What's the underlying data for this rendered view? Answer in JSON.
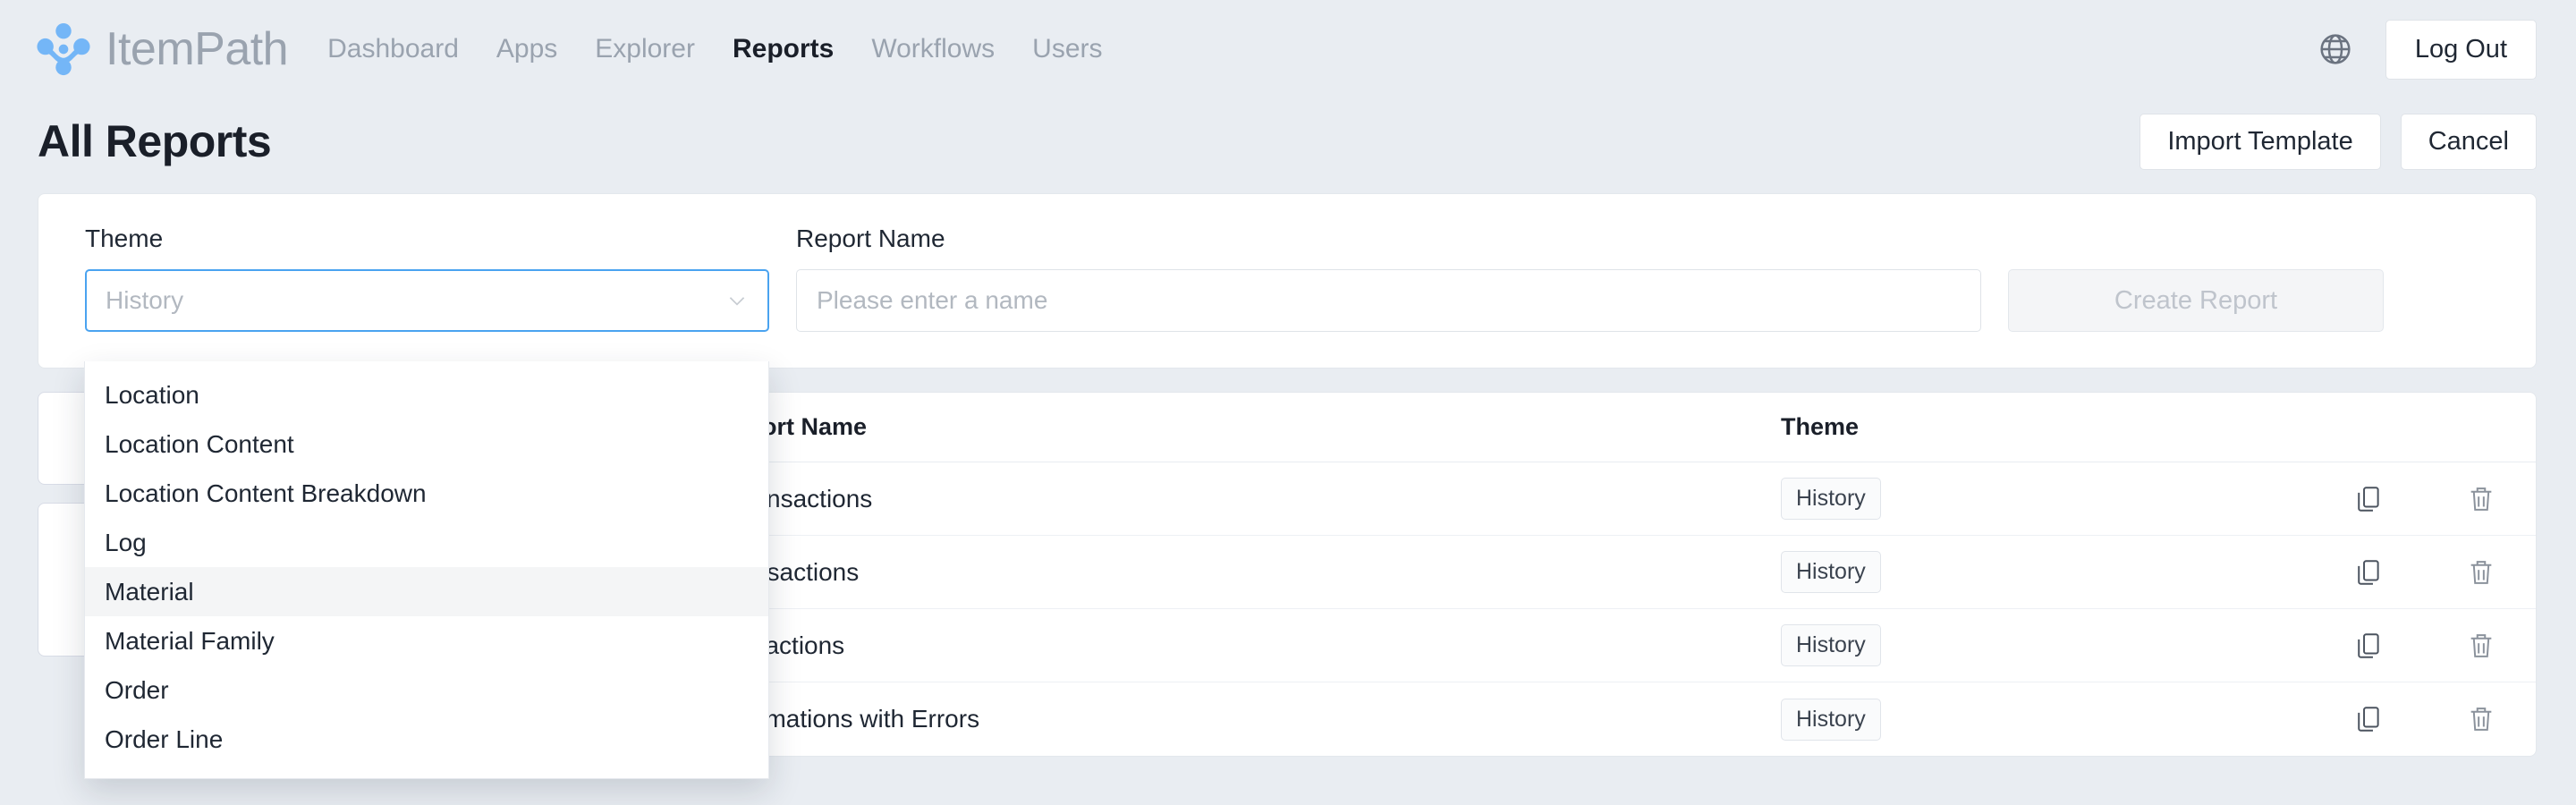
{
  "header": {
    "brand_name": "ItemPath",
    "brand_icon": "itempath-logo-icon",
    "nav": [
      {
        "label": "Dashboard",
        "active": false
      },
      {
        "label": "Apps",
        "active": false
      },
      {
        "label": "Explorer",
        "active": false
      },
      {
        "label": "Reports",
        "active": true
      },
      {
        "label": "Workflows",
        "active": false
      },
      {
        "label": "Users",
        "active": false
      }
    ],
    "language_icon": "globe-icon",
    "logout_label": "Log Out"
  },
  "titlebar": {
    "title": "All Reports",
    "import_label": "Import Template",
    "cancel_label": "Cancel"
  },
  "create_panel": {
    "theme_label": "Theme",
    "theme_value": "History",
    "chevron_icon": "chevron-down-icon",
    "name_label": "Report Name",
    "name_value": "",
    "name_placeholder": "Please enter a name",
    "create_label": "Create Report",
    "create_disabled": true
  },
  "theme_dropdown": {
    "options": [
      {
        "label": "Location",
        "highlighted": false
      },
      {
        "label": "Location Content",
        "highlighted": false
      },
      {
        "label": "Location Content Breakdown",
        "highlighted": false
      },
      {
        "label": "Log",
        "highlighted": false
      },
      {
        "label": "Material",
        "highlighted": true
      },
      {
        "label": "Material Family",
        "highlighted": false
      },
      {
        "label": "Order",
        "highlighted": false
      },
      {
        "label": "Order Line",
        "highlighted": false
      }
    ]
  },
  "reports_table": {
    "columns": {
      "name": "Report Name",
      "theme": "Theme"
    },
    "copy_icon": "copy-icon",
    "delete_icon": "trash-icon",
    "rows": [
      {
        "name": "t Transactions",
        "theme": "History"
      },
      {
        "name": "Transactions",
        "theme": "History"
      },
      {
        "name": "ransactions",
        "theme": "History"
      },
      {
        "name": "onfirmations with Errors",
        "theme": "History"
      }
    ]
  },
  "colors": {
    "background": "#e9edf2",
    "accent": "#4aa3f0",
    "logo_blue": "#74b6f7",
    "text": "#1f2733",
    "muted": "#9aa3af"
  }
}
